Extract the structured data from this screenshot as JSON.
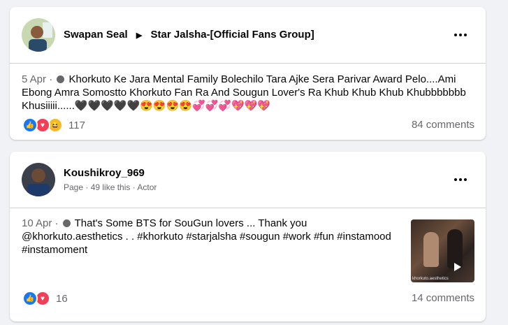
{
  "posts": [
    {
      "author": "Swapan Seal",
      "group": "Star Jalsha-[Official Fans Group]",
      "date": "5 Apr",
      "text": "Khorkuto Ke Jara Mental Family Bolechilo Tara Ajke Sera Parivar Award Pelo....Ami Ebong Amra Somostto Khorkuto Fan Ra And Sougun Lover's Ra Khub Khub Khub Khubbbbbbb Khusiiiii......",
      "emoji_line": "🖤🖤🖤🖤🖤😍😍😍😍💞💞💞💖💖💖",
      "reaction_count": "117",
      "comments": "84 comments",
      "reaction_icons": [
        "like-icon",
        "love-icon",
        "haha-icon"
      ]
    },
    {
      "author": "Koushikroy_969",
      "subline": "Page · 49 like this · Actor",
      "date": "10 Apr",
      "text": "That's Some BTS for SouGun lovers ... Thank you @khorkuto.aesthetics . . #khorkuto #starjalsha #sougun #work #fun #instamood #instamoment",
      "thumb_watermark": "khorkuto.aesthetics",
      "reaction_count": "16",
      "comments": "14 comments",
      "reaction_icons": [
        "like-icon",
        "love-icon"
      ]
    }
  ],
  "colors": {
    "background": "#f0f2f5",
    "card": "#ffffff",
    "secondary_text": "#65676b",
    "like_blue": "#1877f2",
    "love_red": "#f33e58",
    "haha_yellow": "#f7b928"
  }
}
